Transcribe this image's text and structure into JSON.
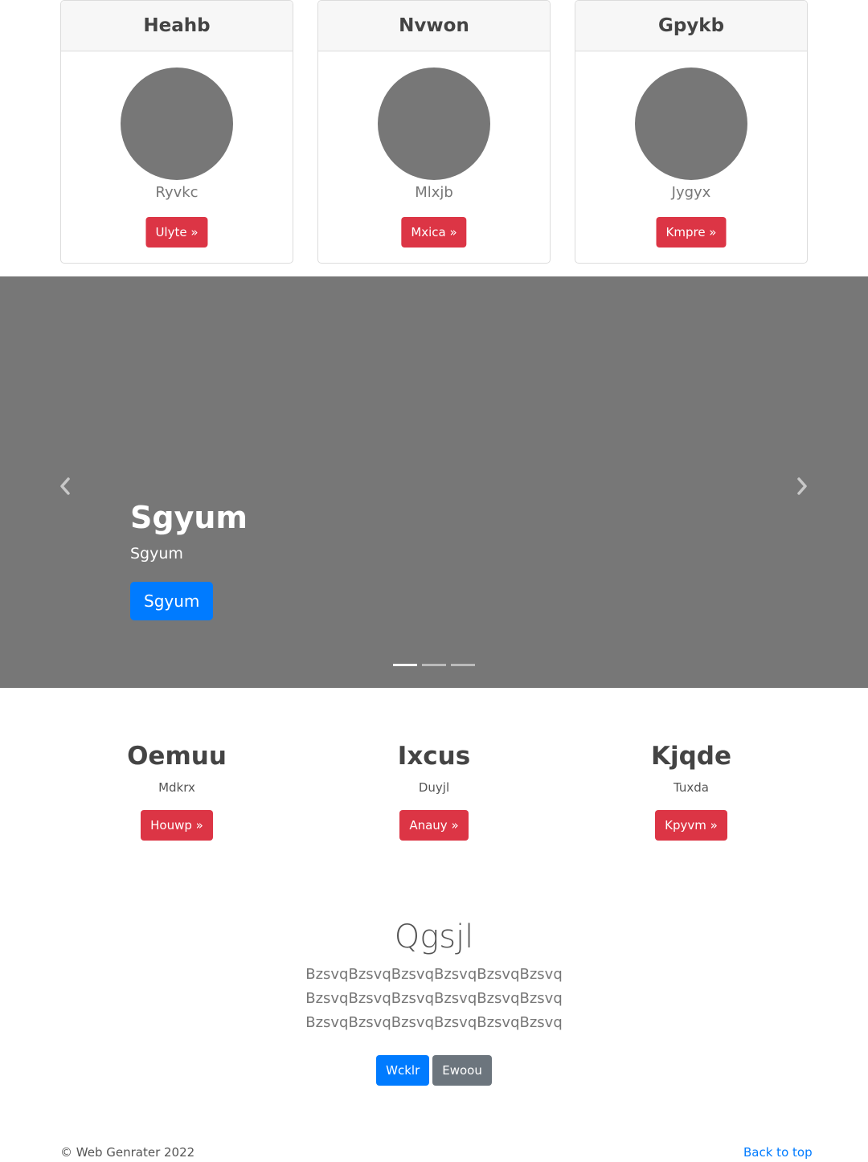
{
  "cards": [
    {
      "title": "Heahb",
      "subtitle": "Ryvkc",
      "button": "Ulyte »"
    },
    {
      "title": "Nvwon",
      "subtitle": "Mlxjb",
      "button": "Mxica »"
    },
    {
      "title": "Gpykb",
      "subtitle": "Jygyx",
      "button": "Kmpre »"
    }
  ],
  "carousel": {
    "title": "Sgyum",
    "text": "Sgyum",
    "button": "Sgyum",
    "prev_icon": "chevron-left-icon",
    "next_icon": "chevron-right-icon",
    "indicator_count": 3,
    "active_index": 0
  },
  "features": [
    {
      "title": "Oemuu",
      "subtitle": "Mdkrx",
      "button": "Houwp »"
    },
    {
      "title": "Ixcus",
      "subtitle": "Duyjl",
      "button": "Anauy »"
    },
    {
      "title": "Kjqde",
      "subtitle": "Tuxda",
      "button": "Kpyvm »"
    }
  ],
  "jumbo": {
    "title": "Qgsjl",
    "text": "BzsvqBzsvqBzsvqBzsvqBzsvqBzsvq BzsvqBzsvqBzsvqBzsvqBzsvqBzsvq BzsvqBzsvqBzsvqBzsvqBzsvqBzsvq",
    "primary_button": "Wcklr",
    "secondary_button": "Ewoou"
  },
  "footer": {
    "copyright": "© Web Genrater 2022",
    "back_to_top": "Back to top"
  },
  "colors": {
    "danger": "#dc3545",
    "primary": "#007bff",
    "secondary": "#6c757d",
    "placeholder": "#777777"
  }
}
